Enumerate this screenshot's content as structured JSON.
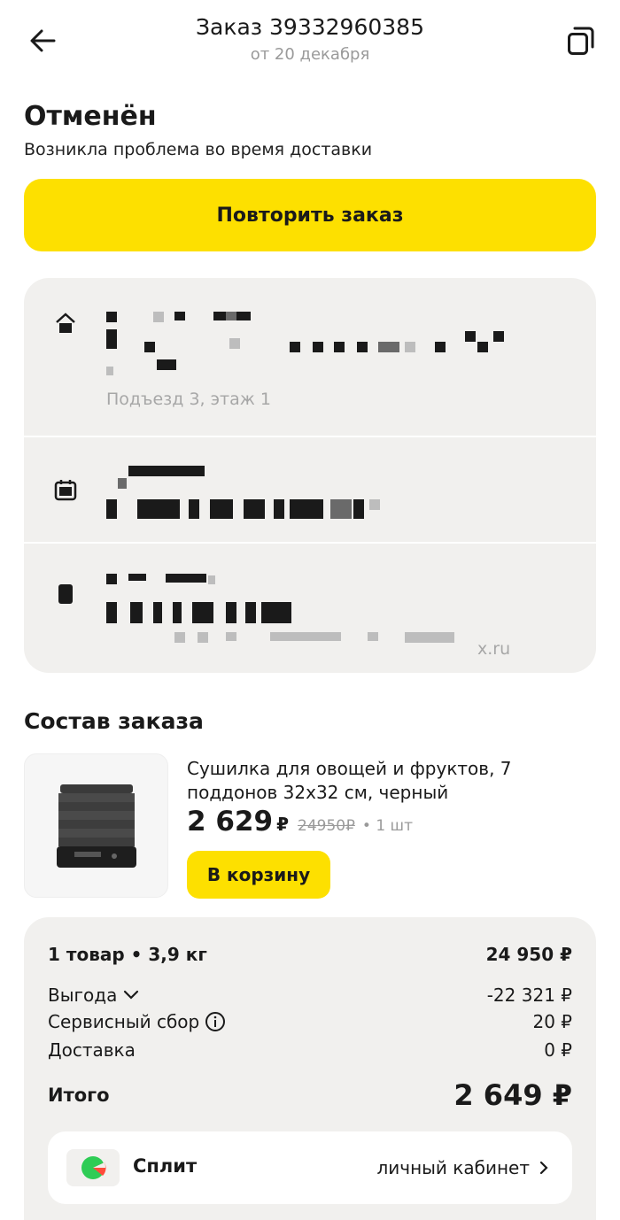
{
  "header": {
    "title": "Заказ 3933296038​5",
    "subtitle": "от 20 декабря"
  },
  "status": {
    "title": "Отменён",
    "subtitle": "Возникла проблема во время доставки"
  },
  "repeat_button_label": "Повторить заказ",
  "delivery": {
    "address_hint": "Подъезд 3, этаж 1",
    "email_suffix": "x.ru"
  },
  "order_section_title": "Состав заказа",
  "product": {
    "name": "Сушилка для овощей и фруктов, 7 поддонов 32x32 см, черный",
    "price": "2 629",
    "currency": "₽",
    "old_price": "24950₽",
    "quantity": "• 1 шт",
    "cart_button_label": "В корзину"
  },
  "summary": {
    "items_label": "1 товар • 3,9 кг",
    "items_value": "24 950 ₽",
    "benefit_label": "Выгода",
    "benefit_value": "-22 321 ₽",
    "service_label": "Сервисный сбор",
    "service_value": "20 ₽",
    "delivery_label": "Доставка",
    "delivery_value": "0 ₽",
    "total_label": "Итого",
    "total_value": "2 649 ₽"
  },
  "split": {
    "label": "Сплит",
    "link_label": "личный кабинет"
  },
  "colors": {
    "accent_yellow": "#fde000",
    "card_bg": "#f1f0ee",
    "muted_text": "#9a9a9a",
    "split_green": "#2ecc55",
    "split_red": "#ff4b3a"
  },
  "icons": {
    "back": "arrow-left-icon",
    "copy": "copy-icon",
    "address": "house-icon",
    "calendar": "calendar-icon",
    "contact": "phone-icon",
    "benefit_toggle": "chevron-down-icon",
    "service_info": "info-icon",
    "split_link": "chevron-right-icon"
  }
}
